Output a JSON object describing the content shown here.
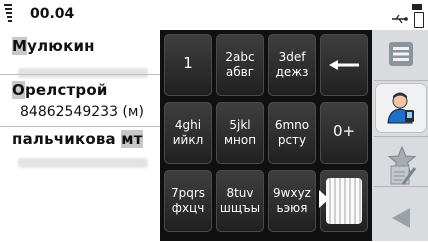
{
  "status_bar": {
    "time": "00.04"
  },
  "contacts": [
    {
      "name_highlight": "М",
      "name_rest": "улюкин",
      "number": ""
    },
    {
      "name_highlight": "О",
      "name_rest": "релстрой",
      "number": "84862549233 (м)"
    },
    {
      "name_prefix": "пальчикова ",
      "name_highlight": "мт",
      "name_rest": "",
      "number": ""
    }
  ],
  "keypad": {
    "row1": [
      {
        "top": "1",
        "bottom": ""
      },
      {
        "top": "2abc",
        "bottom": "абвг"
      },
      {
        "top": "3def",
        "bottom": "дежз"
      },
      {
        "icon": "backspace-icon"
      }
    ],
    "row2": [
      {
        "top": "4ghi",
        "bottom": "ийкл"
      },
      {
        "top": "5jkl",
        "bottom": "мноп"
      },
      {
        "top": "6mno",
        "bottom": "рсту"
      },
      {
        "top": "0+",
        "bottom": ""
      }
    ],
    "row3": [
      {
        "top": "7pqrs",
        "bottom": "фхцч"
      },
      {
        "top": "8tuv",
        "bottom": "шщъы"
      },
      {
        "top": "9wxyz",
        "bottom": "ьэюя"
      },
      {
        "icon": "keypad-collapse-handle"
      }
    ]
  },
  "sidebar": {
    "icons": [
      "list-icon",
      "contacts-icon",
      "favorites-star-icon",
      "notes-icon",
      "back-arrow-icon"
    ]
  },
  "colors": {
    "keypad_bg": "#101010",
    "key": "#2d2d2d",
    "highlight": "#c8c8c8",
    "sidebar": "#d9dbde"
  }
}
